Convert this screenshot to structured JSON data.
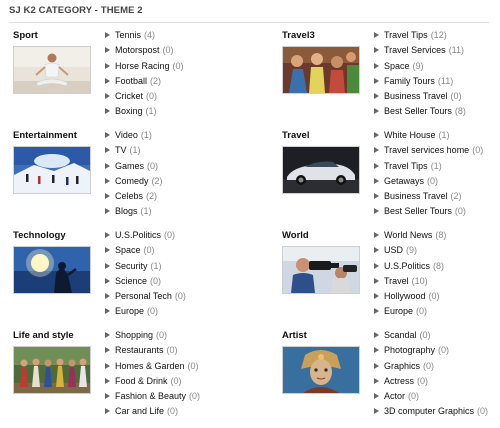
{
  "header": {
    "title": "SJ K2 CATEGORY - THEME 2"
  },
  "categories": [
    {
      "name": "Sport",
      "image": "yoga-meditation-photo",
      "items": [
        {
          "label": "Tennis",
          "count": "(4)"
        },
        {
          "label": "Motorspost",
          "count": "(0)"
        },
        {
          "label": "Horse Racing",
          "count": "(0)"
        },
        {
          "label": "Football",
          "count": "(2)"
        },
        {
          "label": "Cricket",
          "count": "(0)"
        },
        {
          "label": "Boxing",
          "count": "(1)"
        }
      ]
    },
    {
      "name": "Travel3",
      "image": "party-crowd-photo",
      "items": [
        {
          "label": "Travel Tips",
          "count": "(12)"
        },
        {
          "label": "Travel Services",
          "count": "(11)"
        },
        {
          "label": "Space",
          "count": "(9)"
        },
        {
          "label": "Family Tours",
          "count": "(11)"
        },
        {
          "label": "Business Travel",
          "count": "(0)"
        },
        {
          "label": "Best Seller Tours",
          "count": "(8)"
        }
      ]
    },
    {
      "name": "Entertainment",
      "image": "snow-skiers-photo",
      "items": [
        {
          "label": "Video",
          "count": "(1)"
        },
        {
          "label": "TV",
          "count": "(1)"
        },
        {
          "label": "Games",
          "count": "(0)"
        },
        {
          "label": "Comedy",
          "count": "(2)"
        },
        {
          "label": "Celebs",
          "count": "(2)"
        },
        {
          "label": "Blogs",
          "count": "(1)"
        }
      ]
    },
    {
      "name": "Travel",
      "image": "sports-car-photo",
      "items": [
        {
          "label": "White House",
          "count": "(1)"
        },
        {
          "label": "Travel services home",
          "count": "(0)"
        },
        {
          "label": "Travel Tips",
          "count": "(1)"
        },
        {
          "label": "Getaways",
          "count": "(0)"
        },
        {
          "label": "Business Travel",
          "count": "(2)"
        },
        {
          "label": "Best Seller Tours",
          "count": "(0)"
        }
      ]
    },
    {
      "name": "Technology",
      "image": "sunset-silhouette-photo",
      "items": [
        {
          "label": "U.S.Politics",
          "count": "(0)"
        },
        {
          "label": "Space",
          "count": "(0)"
        },
        {
          "label": "Security",
          "count": "(1)"
        },
        {
          "label": "Science",
          "count": "(0)"
        },
        {
          "label": "Personal Tech",
          "count": "(0)"
        },
        {
          "label": "Europe",
          "count": "(0)"
        }
      ]
    },
    {
      "name": "World",
      "image": "photographers-photo",
      "items": [
        {
          "label": "World News",
          "count": "(8)"
        },
        {
          "label": "USD",
          "count": "(9)"
        },
        {
          "label": "U.S.Politics",
          "count": "(8)"
        },
        {
          "label": "Travel",
          "count": "(10)"
        },
        {
          "label": "Hollywood",
          "count": "(0)"
        },
        {
          "label": "Europe",
          "count": "(0)"
        }
      ]
    },
    {
      "name": "Life and style",
      "image": "folk-costume-group-photo",
      "items": [
        {
          "label": "Shopping",
          "count": "(0)"
        },
        {
          "label": "Restaurants",
          "count": "(0)"
        },
        {
          "label": "Homes & Garden",
          "count": "(0)"
        },
        {
          "label": "Food & Drink",
          "count": "(0)"
        },
        {
          "label": "Fashion & Beauty",
          "count": "(0)"
        },
        {
          "label": "Car and Life",
          "count": "(0)"
        }
      ]
    },
    {
      "name": "Artist",
      "image": "fantasy-portrait-photo",
      "items": [
        {
          "label": "Scandal",
          "count": "(0)"
        },
        {
          "label": "Photography",
          "count": "(0)"
        },
        {
          "label": "Graphics",
          "count": "(0)"
        },
        {
          "label": "Actress",
          "count": "(0)"
        },
        {
          "label": "Actor",
          "count": "(0)"
        },
        {
          "label": "3D computer Graphics",
          "count": "(0)"
        }
      ]
    }
  ]
}
